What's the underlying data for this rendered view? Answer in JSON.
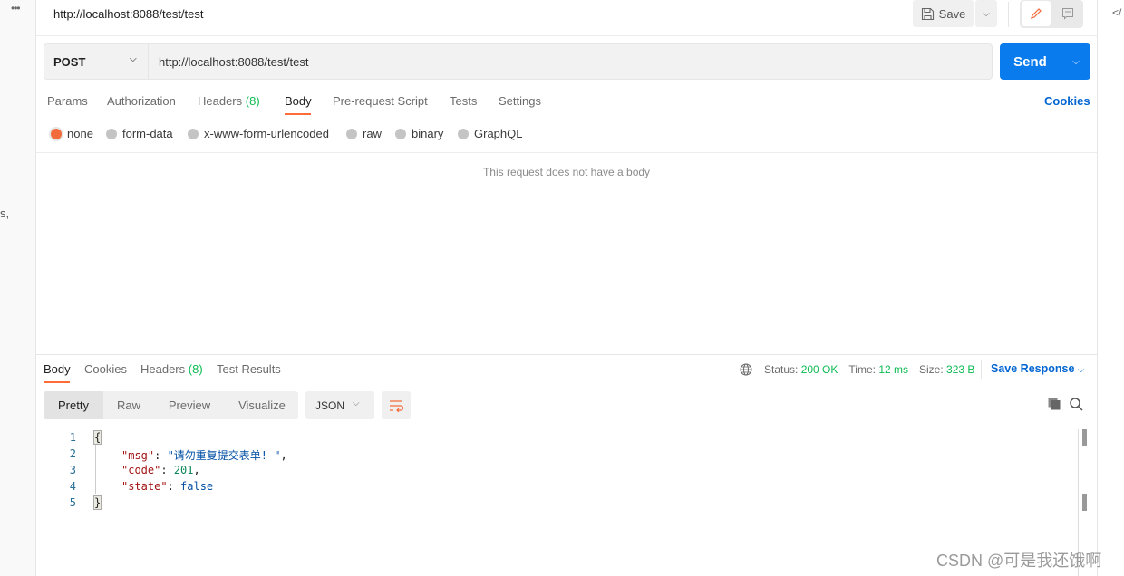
{
  "sidebar": {
    "more_icon": "ellipsis-icon",
    "partial_text": "s,"
  },
  "header": {
    "title": "http://localhost:8088/test/test",
    "save_label": "Save"
  },
  "request": {
    "method": "POST",
    "url": "http://localhost:8088/test/test",
    "send_label": "Send"
  },
  "request_tabs": [
    {
      "label": "Params"
    },
    {
      "label": "Authorization"
    },
    {
      "label": "Headers",
      "count": "(8)"
    },
    {
      "label": "Body",
      "active": true
    },
    {
      "label": "Pre-request Script"
    },
    {
      "label": "Tests"
    },
    {
      "label": "Settings"
    }
  ],
  "cookies_label": "Cookies",
  "body_types": [
    {
      "label": "none",
      "selected": true
    },
    {
      "label": "form-data"
    },
    {
      "label": "x-www-form-urlencoded"
    },
    {
      "label": "raw"
    },
    {
      "label": "binary"
    },
    {
      "label": "GraphQL"
    }
  ],
  "empty_body_message": "This request does not have a body",
  "response": {
    "tabs": [
      {
        "label": "Body",
        "active": true
      },
      {
        "label": "Cookies"
      },
      {
        "label": "Headers",
        "count": "(8)"
      },
      {
        "label": "Test Results"
      }
    ],
    "status_label": "Status:",
    "status": "200 OK",
    "time_label": "Time:",
    "time": "12 ms",
    "size_label": "Size:",
    "size": "323 B",
    "save_response": "Save Response",
    "view_modes": [
      "Pretty",
      "Raw",
      "Preview",
      "Visualize"
    ],
    "format": "JSON",
    "code": {
      "line_numbers": [
        "1",
        "2",
        "3",
        "4",
        "5"
      ],
      "open": "{",
      "close": "}",
      "lines": [
        {
          "key": "\"msg\"",
          "value": "\"请勿重复提交表单! \"",
          "tail": ","
        },
        {
          "key": "\"code\"",
          "value": "201",
          "tail": ","
        },
        {
          "key": "\"state\"",
          "value": "false",
          "tail": ""
        }
      ]
    }
  },
  "watermark": "CSDN @可是我还饿啊",
  "right_panel": {
    "code_icon_text": "</"
  },
  "colors": {
    "accent": "#ff6c37",
    "send": "#097bed",
    "link": "#0265d2",
    "success": "#0cbb52"
  }
}
